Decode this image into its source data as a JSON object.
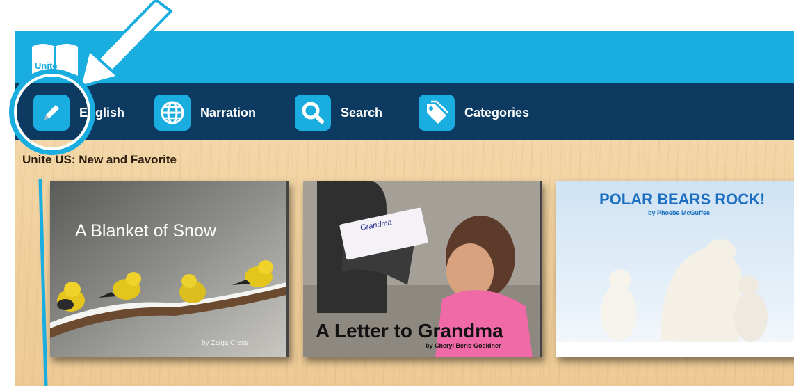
{
  "app": {
    "logo_text": "Unite"
  },
  "nav": {
    "items": [
      {
        "label": "English",
        "icon": "pencil-icon"
      },
      {
        "label": "Narration",
        "icon": "globe-icon"
      },
      {
        "label": "Search",
        "icon": "magnifier-icon"
      },
      {
        "label": "Categories",
        "icon": "tag-icon"
      }
    ]
  },
  "section": {
    "title": "Unite US:   New and Favorite"
  },
  "books": [
    {
      "title": "A Blanket of Snow",
      "author": "by Zaiga Cress"
    },
    {
      "title": "A Letter to Grandma",
      "author": "by Cheryl Berio Goeldner",
      "note": "Grandma"
    },
    {
      "title": "POLAR BEARS ROCK!",
      "author": "by Phoebe McGuffee"
    }
  ],
  "colors": {
    "topbar": "#1aaddf",
    "navbar": "#0c3a60",
    "annotation": "#1aaddf"
  }
}
